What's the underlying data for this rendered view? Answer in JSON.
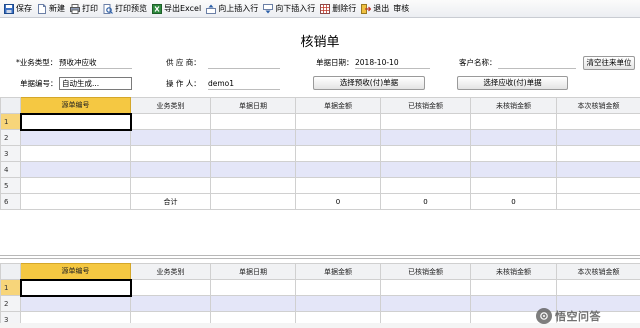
{
  "toolbar": {
    "items": [
      {
        "label": "保存",
        "icon": "save-icon"
      },
      {
        "label": "新建",
        "icon": "new-icon"
      },
      {
        "label": "打印",
        "icon": "print-icon"
      },
      {
        "label": "打印预览",
        "icon": "print-preview-icon"
      },
      {
        "label": "导出Excel",
        "icon": "excel-icon"
      },
      {
        "label": "向上插入行",
        "icon": "insert-up-icon"
      },
      {
        "label": "向下插入行",
        "icon": "insert-down-icon"
      },
      {
        "label": "删除行",
        "icon": "delete-row-icon"
      },
      {
        "label": "退出",
        "icon": "exit-icon"
      },
      {
        "label": "审核",
        "icon": ""
      }
    ]
  },
  "form": {
    "title": "核销单",
    "business_type_label": "*业务类型：",
    "business_type_value": "预收冲应收",
    "supplier_label": "供 应 商：",
    "supplier_value": "",
    "doc_date_label": "单据日期：",
    "doc_date_value": "2018-10-10",
    "customer_label": "客户名称：",
    "customer_value": "",
    "clear_button": "清空往来单位",
    "doc_no_label": "单据编号：",
    "doc_no_value": "自动生成...",
    "operator_label": "操 作 人：",
    "operator_value": "demo1",
    "select_prepay_button": "选择预收(付)单据",
    "select_receivable_button": "选择应收(付)单据"
  },
  "grid1": {
    "headers": [
      "源单编号",
      "业务类别",
      "单据日期",
      "单据金额",
      "已核销金额",
      "未核销金额",
      "本次核销金额"
    ],
    "rows": [
      "1",
      "2",
      "3",
      "4",
      "5"
    ],
    "total": {
      "row_no": "6",
      "label": "合计",
      "amount": "0",
      "verified": "0",
      "unverified": "0"
    }
  },
  "grid2": {
    "headers": [
      "源单编号",
      "业务类别",
      "单据日期",
      "单据金额",
      "已核销金额",
      "未核销金额",
      "本次核销金额"
    ],
    "rows": [
      "1",
      "2",
      "3"
    ]
  },
  "watermark": {
    "text": "悟空问答"
  }
}
